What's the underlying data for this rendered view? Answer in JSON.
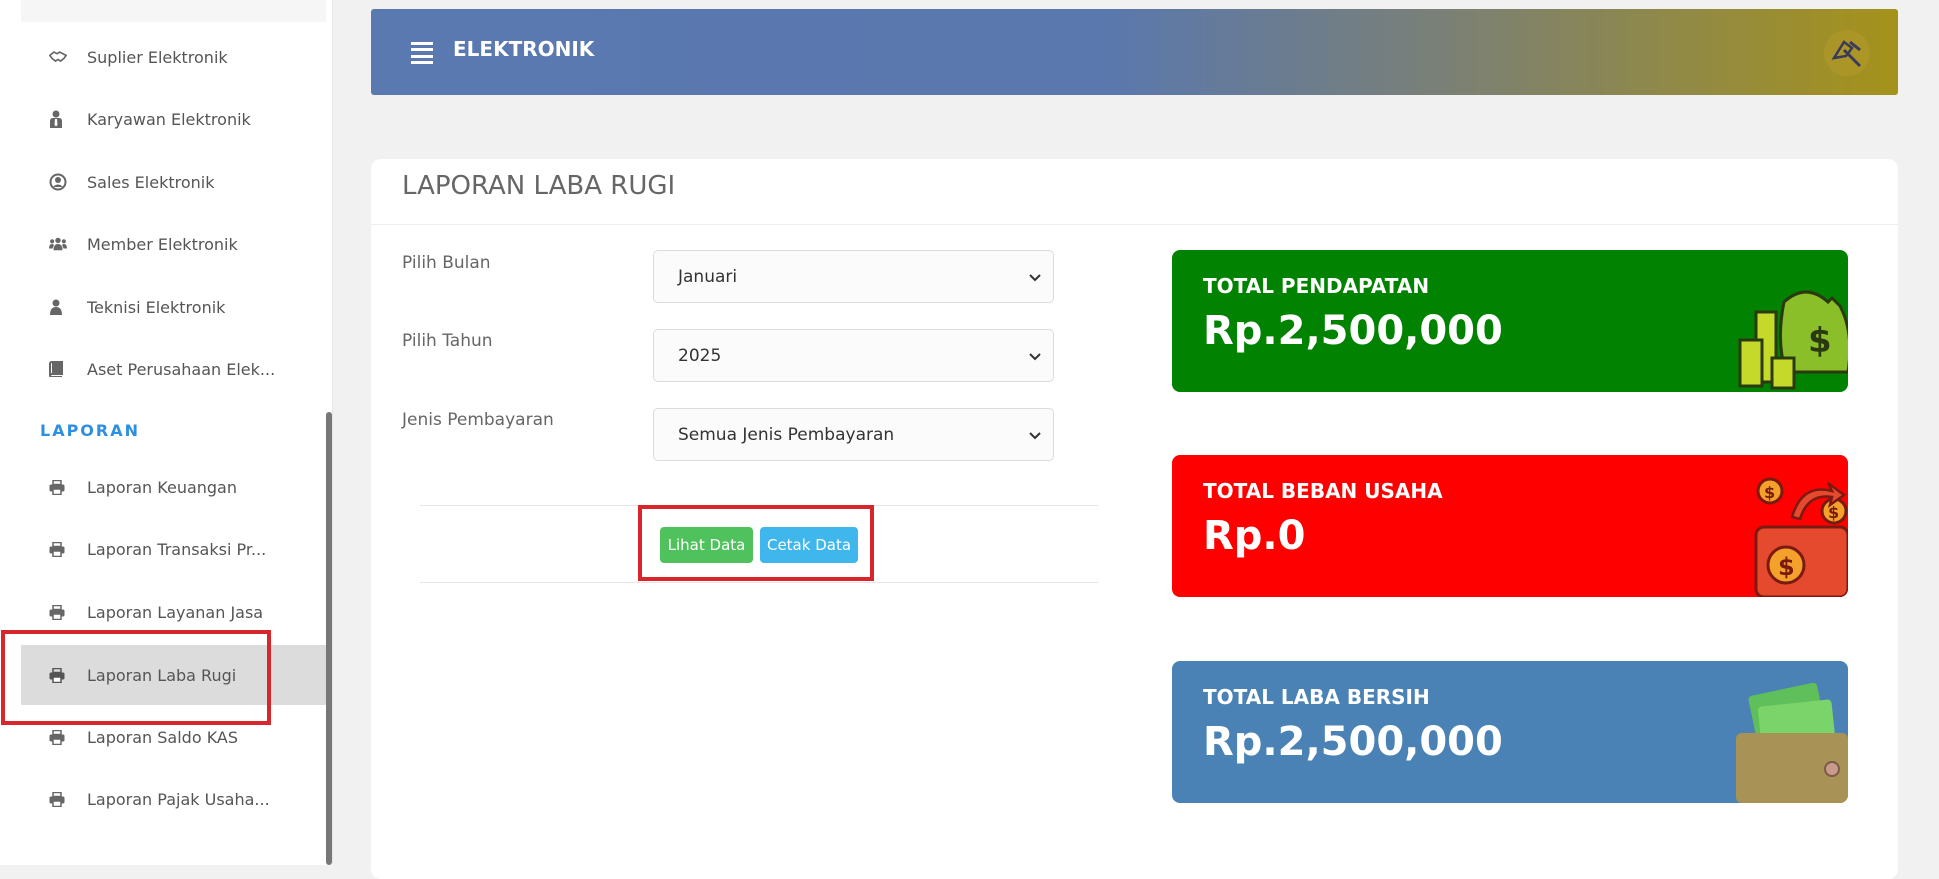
{
  "app": {
    "title": "ELEKTRONIK"
  },
  "sidebar": {
    "items": [
      {
        "label": "Suplier Elektronik",
        "icon": "handshake-icon"
      },
      {
        "label": "Karyawan Elektronik",
        "icon": "user-tie-icon"
      },
      {
        "label": "Sales Elektronik",
        "icon": "user-circle-icon"
      },
      {
        "label": "Member Elektronik",
        "icon": "users-icon"
      },
      {
        "label": "Teknisi Elektronik",
        "icon": "user-icon"
      },
      {
        "label": "Aset Perusahaan Elek...",
        "icon": "book-icon"
      }
    ],
    "section_label": "LAPORAN",
    "report_items": [
      {
        "label": "Laporan Keuangan",
        "icon": "printer-icon"
      },
      {
        "label": "Laporan Transaksi Pr...",
        "icon": "printer-icon"
      },
      {
        "label": "Laporan Layanan Jasa",
        "icon": "printer-icon"
      },
      {
        "label": "Laporan Laba Rugi",
        "icon": "printer-icon",
        "active": true
      },
      {
        "label": "Laporan Saldo KAS",
        "icon": "printer-icon"
      },
      {
        "label": "Laporan Pajak Usaha...",
        "icon": "printer-icon"
      }
    ]
  },
  "page": {
    "title": "LAPORAN LABA RUGI",
    "form": {
      "month_label": "Pilih Bulan",
      "month_value": "Januari",
      "year_label": "Pilih Tahun",
      "year_value": "2025",
      "payment_label": "Jenis Pembayaran",
      "payment_value": "Semua Jenis Pembayaran"
    },
    "buttons": {
      "view_label": "Lihat Data",
      "print_label": "Cetak Data"
    }
  },
  "stats": {
    "revenue": {
      "label": "TOTAL PENDAPATAN",
      "value": "Rp.2,500,000",
      "color": "#018201"
    },
    "expense": {
      "label": "TOTAL BEBAN USAHA",
      "value": "Rp.0",
      "color": "#ff0000"
    },
    "profit": {
      "label": "TOTAL LABA BERSIH",
      "value": "Rp.2,500,000",
      "color": "#4a82b5"
    }
  },
  "colors": {
    "accent": "#2d8fde",
    "highlight": "#d9262c",
    "button_view": "#50c25d",
    "button_print": "#3fb7ec"
  }
}
